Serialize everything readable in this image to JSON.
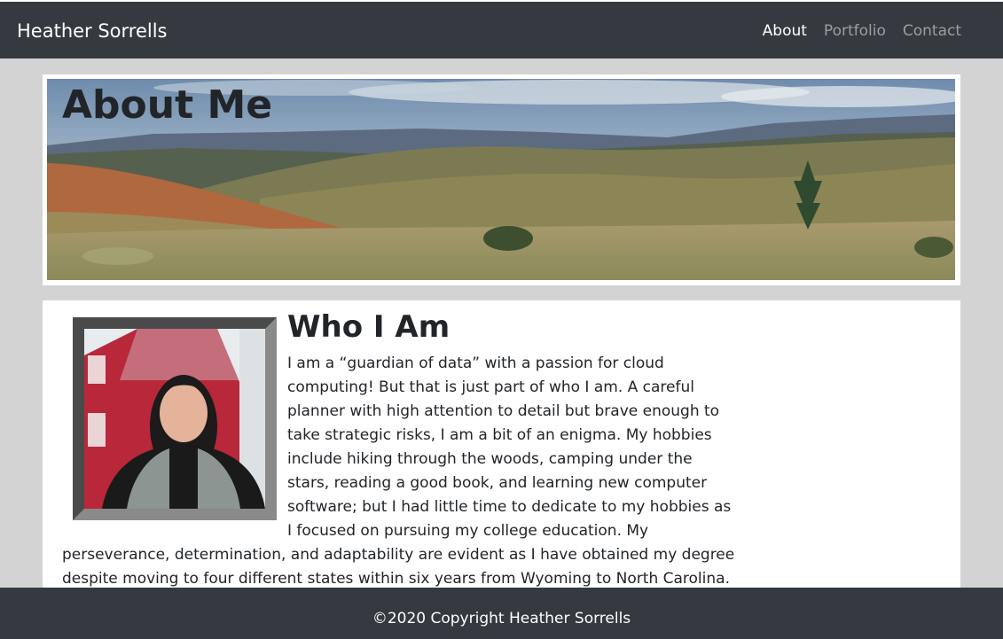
{
  "navbar": {
    "brand": "Heather Sorrells",
    "links": [
      {
        "label": "About",
        "active": true
      },
      {
        "label": "Portfolio",
        "active": false
      },
      {
        "label": "Contact",
        "active": false
      }
    ]
  },
  "hero": {
    "title": "About Me"
  },
  "main": {
    "section_title": "Who I Am",
    "bio": "I am a “guardian of data” with a passion for cloud computing! But that is just part of who I am. A careful planner with high attention to detail but brave enough to take strategic risks, I am a bit of an enigma. My hobbies include hiking through the woods, camping under the stars, reading a good book, and learning new computer software; but I had little time to dedicate to my hobbies as I focused on pursuing my college education. My perseverance, determination, and adaptability are evident as I have obtained my degree despite moving to four different states within six years from Wyoming to North Carolina. While I will always"
  },
  "footer": {
    "text": "©2020 Copyright Heather Sorrells"
  },
  "colors": {
    "navbar_bg": "#343a40",
    "page_bg": "#d3d3d3",
    "card_bg": "#ffffff",
    "text": "#212529"
  }
}
